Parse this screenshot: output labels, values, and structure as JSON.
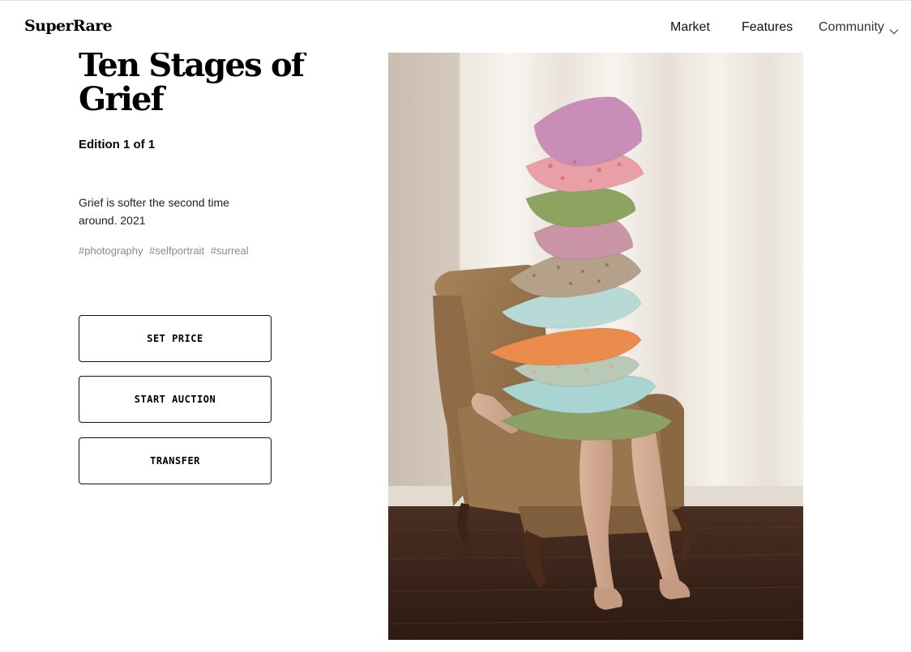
{
  "header": {
    "logo": "SuperRare",
    "nav": {
      "market": "Market",
      "features": "Features",
      "community": "Community"
    }
  },
  "artwork": {
    "title": "Ten Stages of Grief",
    "edition": "Edition 1 of 1",
    "description": "Grief is softer the second time around. 2021",
    "tags": [
      "#photography",
      "#selfportrait",
      "#surreal"
    ]
  },
  "actions": {
    "set_price": "SET PRICE",
    "start_auction": "START AUCTION",
    "transfer": "TRANSFER"
  },
  "icons": {
    "community_dropdown": "chevron-down-icon"
  },
  "colors": {
    "text": "#111111",
    "tag_gray": "#8a8a8a",
    "border": "#111111",
    "background": "#ffffff"
  }
}
